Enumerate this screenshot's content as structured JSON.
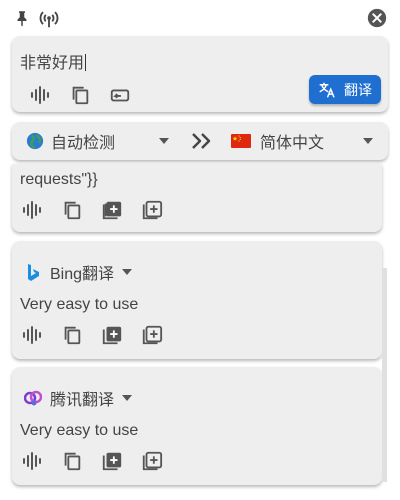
{
  "toolbar": {
    "pin_icon": "pin-icon",
    "broadcast_icon": "radio-tower-icon",
    "close_icon": "close-circle-icon"
  },
  "input": {
    "text": "非常好用"
  },
  "translate_button": {
    "label": "翻译",
    "icon": "translate-icon",
    "color": "#1f6fd1"
  },
  "languages": {
    "source": "自动检测",
    "target": "简体中文",
    "swap_icon": "double-chevron-right-icon"
  },
  "results": [
    {
      "service": "",
      "text": "requests\"}}"
    },
    {
      "service": "Bing翻译",
      "text": "Very easy to use",
      "logo": "bing-logo-icon"
    },
    {
      "service": "腾讯翻译",
      "text": "Very easy to use",
      "logo": "tencent-logo-icon"
    }
  ],
  "colors": {
    "card_bg": "#eeeeee",
    "accent": "#1f6fd1",
    "icon": "#555555"
  }
}
